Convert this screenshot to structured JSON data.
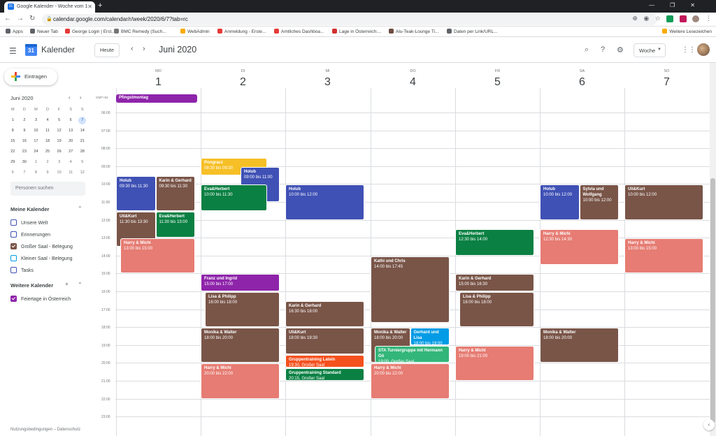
{
  "browser": {
    "tab_title": "Google Kalender - Woche vom 1",
    "url": "calendar.google.com/calendar/r/week/2020/6/7?tab=rc",
    "bookmarks": [
      {
        "label": "Apps",
        "color": "#5f6368"
      },
      {
        "label": "Neuer Tab",
        "color": "#5f6368"
      },
      {
        "label": "George Login | Erst...",
        "color": "#e53935"
      },
      {
        "label": "BMC Remedy (Such...",
        "color": "#757575"
      },
      {
        "label": "WebAdmin",
        "color": "#f9ab00"
      },
      {
        "label": "Anmeldung - Erste...",
        "color": "#e53935"
      },
      {
        "label": "Amtliches Dashboa...",
        "color": "#e53935"
      },
      {
        "label": "Lage in Österreich:...",
        "color": "#d32f2f"
      },
      {
        "label": "Alu-Teak-Lounge Ti...",
        "color": "#6d4c41"
      },
      {
        "label": "Daten per Link/URL...",
        "color": "#5f6368"
      }
    ],
    "bookmarks_right": "Weitere Lesezeichen"
  },
  "header": {
    "app_name": "Kalender",
    "logo_day": "31",
    "today": "Heute",
    "month": "Juni 2020",
    "view": "Woche"
  },
  "sidebar": {
    "create": "Eintragen",
    "mini_title": "Juni 2020",
    "mini_dow": [
      "M",
      "D",
      "M",
      "D",
      "F",
      "S",
      "S"
    ],
    "mini_weeks": [
      [
        "1",
        "2",
        "3",
        "4",
        "5",
        "6",
        "7"
      ],
      [
        "8",
        "9",
        "10",
        "11",
        "12",
        "13",
        "14"
      ],
      [
        "15",
        "16",
        "17",
        "18",
        "19",
        "20",
        "21"
      ],
      [
        "22",
        "23",
        "24",
        "25",
        "26",
        "27",
        "28"
      ],
      [
        "29",
        "30",
        "1",
        "2",
        "3",
        "4",
        "5"
      ],
      [
        "6",
        "7",
        "8",
        "9",
        "10",
        "11",
        "12"
      ]
    ],
    "search_people": "Personen suchen",
    "my_cals_title": "Meine Kalender",
    "my_cals": [
      {
        "label": "Unsere Welt",
        "color": "#3f51b5",
        "checked": false
      },
      {
        "label": "Erinnerungen",
        "color": "#3f51b5",
        "checked": false
      },
      {
        "label": "Großer Saal - Belegung",
        "color": "#795548",
        "checked": true
      },
      {
        "label": "Kleiner Saal - Belegung",
        "color": "#039be5",
        "checked": false
      },
      {
        "label": "Tasks",
        "color": "#3f51b5",
        "checked": false
      }
    ],
    "other_cals_title": "Weitere Kalender",
    "other_cals": [
      {
        "label": "Feiertage in Österreich",
        "color": "#8e24aa",
        "checked": true
      }
    ],
    "footer": "Nutzungsbedingungen – Datenschutz"
  },
  "week": {
    "gmt": "GMT+02",
    "days": [
      {
        "dow": "MO",
        "num": "1"
      },
      {
        "dow": "DI",
        "num": "2"
      },
      {
        "dow": "MI",
        "num": "3"
      },
      {
        "dow": "DO",
        "num": "4"
      },
      {
        "dow": "FR",
        "num": "5"
      },
      {
        "dow": "SA",
        "num": "6"
      },
      {
        "dow": "SO",
        "num": "7"
      }
    ],
    "hours": [
      "06:00",
      "07:00",
      "08:00",
      "09:00",
      "10:00",
      "11:00",
      "12:00",
      "13:00",
      "14:00",
      "15:00",
      "16:00",
      "17:00",
      "18:00",
      "19:00",
      "20:00",
      "21:00",
      "22:00",
      "23:00"
    ],
    "allday": [
      {
        "day": 0,
        "title": "Pfingstmontag",
        "color": "#8e24aa"
      }
    ]
  },
  "events": [
    {
      "day": 0,
      "start": 9.5,
      "end": 11.5,
      "col": 0,
      "cols": 2,
      "title": "Holub",
      "time": "09:30 bis 11:30",
      "color": "#3f51b5"
    },
    {
      "day": 0,
      "start": 9.5,
      "end": 11.5,
      "col": 1,
      "cols": 2,
      "title": "Karin & Gerhard",
      "time": "09:30 bis 11:30",
      "color": "#795548"
    },
    {
      "day": 0,
      "start": 11.5,
      "end": 13.5,
      "col": 0,
      "cols": 2,
      "title": "Uli&Kurt",
      "time": "11:30 bis 13:30",
      "color": "#795548"
    },
    {
      "day": 0,
      "start": 11.5,
      "end": 13.0,
      "col": 1,
      "cols": 2,
      "title": "Eva&Herbert",
      "time": "11:30 bis 13:00",
      "color": "#0b8043"
    },
    {
      "day": 0,
      "start": 13.0,
      "end": 15.0,
      "col": 0,
      "cols": 1,
      "indent": 6,
      "title": "Harry & Michi",
      "time": "13:00 bis 15:00",
      "color": "#e67c73"
    },
    {
      "day": 1,
      "start": 8.5,
      "end": 9.5,
      "col": 0,
      "cols": 1,
      "title": "Pongracz",
      "time": "08:30 bis 09:30",
      "color": "#f6bf26",
      "wr": 18
    },
    {
      "day": 1,
      "start": 9.0,
      "end": 11.0,
      "col": 0,
      "cols": 1,
      "indent": 57,
      "title": "Holub",
      "time": "09:00 bis 11:00",
      "color": "#3f51b5"
    },
    {
      "day": 1,
      "start": 10.0,
      "end": 11.5,
      "col": 0,
      "cols": 1,
      "title": "Eva&Herbert",
      "time": "10:00 bis 11:30",
      "color": "#0b8043",
      "wr": 18
    },
    {
      "day": 1,
      "start": 15.0,
      "end": 16.0,
      "col": 0,
      "cols": 1,
      "title": "Franz und Ingrid",
      "time": "15:00 bis 17:00",
      "color": "#8e24aa"
    },
    {
      "day": 1,
      "start": 16.0,
      "end": 18.0,
      "col": 0,
      "cols": 1,
      "indent": 6,
      "title": "Lisa & Philipp",
      "time": "16:00 bis 18:00",
      "color": "#795548"
    },
    {
      "day": 1,
      "start": 18.0,
      "end": 20.0,
      "col": 0,
      "cols": 1,
      "title": "Monika & Walter",
      "time": "18:00 bis 20:00",
      "color": "#795548"
    },
    {
      "day": 1,
      "start": 20.0,
      "end": 22.0,
      "col": 0,
      "cols": 1,
      "title": "Harry & Michi",
      "time": "20:00 bis 22:00",
      "color": "#e67c73"
    },
    {
      "day": 2,
      "start": 10.0,
      "end": 12.0,
      "col": 0,
      "cols": 1,
      "title": "Holub",
      "time": "10:00 bis 12:00",
      "color": "#3f51b5"
    },
    {
      "day": 2,
      "start": 16.5,
      "end": 18.0,
      "col": 0,
      "cols": 1,
      "title": "Karin & Gerhard",
      "time": "16:30 bis 18:00",
      "color": "#795548"
    },
    {
      "day": 2,
      "start": 18.0,
      "end": 19.5,
      "col": 0,
      "cols": 1,
      "title": "Uli&Kurt",
      "time": "18:00 bis 19:30",
      "color": "#795548"
    },
    {
      "day": 2,
      "start": 19.5,
      "end": 20.25,
      "col": 0,
      "cols": 1,
      "title": "Gruppentraining Latein",
      "time": "19:30, Großer Saal",
      "color": "#f4511e"
    },
    {
      "day": 2,
      "start": 20.25,
      "end": 21.0,
      "col": 0,
      "cols": 1,
      "title": "Gruppentraining Standard",
      "time": "20:15, Großer Saal",
      "color": "#0b8043"
    },
    {
      "day": 3,
      "start": 14.0,
      "end": 17.75,
      "col": 0,
      "cols": 1,
      "title": "Kathi und Chris",
      "time": "14:00 bis 17:45",
      "color": "#795548"
    },
    {
      "day": 3,
      "start": 18.0,
      "end": 20.0,
      "col": 0,
      "cols": 2,
      "title": "Monika & Walter",
      "time": "18:00 bis 20:00",
      "color": "#795548"
    },
    {
      "day": 3,
      "start": 18.0,
      "end": 19.0,
      "col": 1,
      "cols": 2,
      "title": "Gerhard und Lisa",
      "time": "18:00 bis 19:00",
      "color": "#039be5"
    },
    {
      "day": 3,
      "start": 19.0,
      "end": 20.0,
      "col": 0,
      "cols": 1,
      "indent": 6,
      "title": "STA Turniergruppe mit Hermann Gö",
      "time": "19:00, Großer Saal",
      "color": "#33b679"
    },
    {
      "day": 3,
      "start": 20.0,
      "end": 22.0,
      "col": 0,
      "cols": 1,
      "title": "Harry & Michi",
      "time": "20:00 bis 22:00",
      "color": "#e67c73"
    },
    {
      "day": 4,
      "start": 12.5,
      "end": 14.0,
      "col": 0,
      "cols": 1,
      "title": "Eva&Herbert",
      "time": "12:30 bis 14:00",
      "color": "#0b8043"
    },
    {
      "day": 4,
      "start": 15.0,
      "end": 16.0,
      "col": 0,
      "cols": 1,
      "title": "Karin & Gerhard",
      "time": "15:00 bis 16:30",
      "color": "#795548"
    },
    {
      "day": 4,
      "start": 16.0,
      "end": 18.0,
      "col": 0,
      "cols": 1,
      "indent": 6,
      "title": "Lisa & Philipp",
      "time": "16:00 bis 18:00",
      "color": "#795548"
    },
    {
      "day": 4,
      "start": 19.0,
      "end": 21.0,
      "col": 0,
      "cols": 1,
      "title": "Harry & Michi",
      "time": "19:00 bis 21:00",
      "color": "#e67c73"
    },
    {
      "day": 5,
      "start": 10.0,
      "end": 12.0,
      "col": 0,
      "cols": 2,
      "title": "Holub",
      "time": "10:00 bis 12:00",
      "color": "#3f51b5"
    },
    {
      "day": 5,
      "start": 10.0,
      "end": 12.0,
      "col": 1,
      "cols": 2,
      "title": "Sylvia und Wolfgang",
      "time": "10:00 bis 12:00",
      "color": "#795548"
    },
    {
      "day": 5,
      "start": 12.5,
      "end": 14.5,
      "col": 0,
      "cols": 1,
      "title": "Harry & Michi",
      "time": "12:30 bis 14:30",
      "color": "#e67c73"
    },
    {
      "day": 5,
      "start": 18.0,
      "end": 20.0,
      "col": 0,
      "cols": 1,
      "title": "Monika & Walter",
      "time": "18:00 bis 20:00",
      "color": "#795548"
    },
    {
      "day": 6,
      "start": 10.0,
      "end": 12.0,
      "col": 0,
      "cols": 1,
      "title": "Uli&Kurt",
      "time": "10:00 bis 12:00",
      "color": "#795548"
    },
    {
      "day": 6,
      "start": 13.0,
      "end": 15.0,
      "col": 0,
      "cols": 1,
      "title": "Harry & Michi",
      "time": "13:00 bis 15:00",
      "color": "#e67c73"
    }
  ]
}
